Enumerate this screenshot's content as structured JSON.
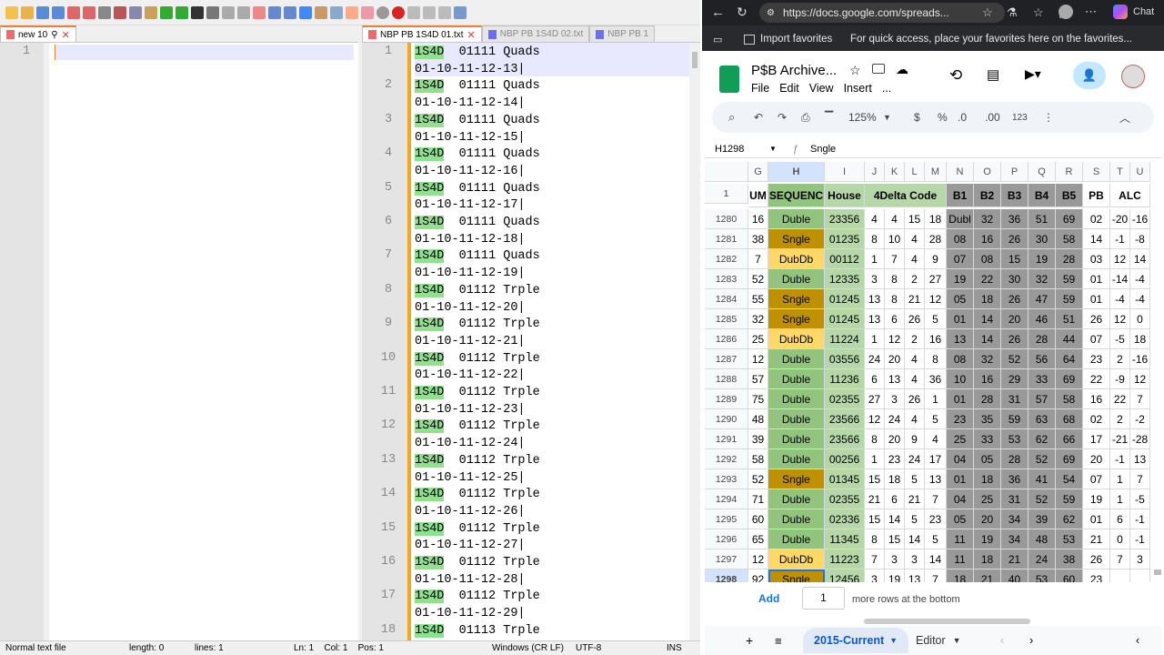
{
  "npp": {
    "tabs": [
      {
        "label": "new 10",
        "active": true
      },
      {
        "label": "NBP PB 1S4D 01.txt",
        "active": true
      },
      {
        "label": "NBP PB 1S4D 02.txt",
        "active": false
      },
      {
        "label": "NBP PB 1",
        "active": false
      }
    ],
    "left_line": "1",
    "right_lines": [
      {
        "n": "1",
        "tag": "1S4D",
        "code": "01111",
        "kind": "Quads",
        "seq": "01-10-11-12-13|"
      },
      {
        "n": "2",
        "tag": "1S4D",
        "code": "01111",
        "kind": "Quads",
        "seq": "01-10-11-12-14|"
      },
      {
        "n": "3",
        "tag": "1S4D",
        "code": "01111",
        "kind": "Quads",
        "seq": "01-10-11-12-15|"
      },
      {
        "n": "4",
        "tag": "1S4D",
        "code": "01111",
        "kind": "Quads",
        "seq": "01-10-11-12-16|"
      },
      {
        "n": "5",
        "tag": "1S4D",
        "code": "01111",
        "kind": "Quads",
        "seq": "01-10-11-12-17|"
      },
      {
        "n": "6",
        "tag": "1S4D",
        "code": "01111",
        "kind": "Quads",
        "seq": "01-10-11-12-18|"
      },
      {
        "n": "7",
        "tag": "1S4D",
        "code": "01111",
        "kind": "Quads",
        "seq": "01-10-11-12-19|"
      },
      {
        "n": "8",
        "tag": "1S4D",
        "code": "01112",
        "kind": "Trple",
        "seq": "01-10-11-12-20|"
      },
      {
        "n": "9",
        "tag": "1S4D",
        "code": "01112",
        "kind": "Trple",
        "seq": "01-10-11-12-21|"
      },
      {
        "n": "10",
        "tag": "1S4D",
        "code": "01112",
        "kind": "Trple",
        "seq": "01-10-11-12-22|"
      },
      {
        "n": "11",
        "tag": "1S4D",
        "code": "01112",
        "kind": "Trple",
        "seq": "01-10-11-12-23|"
      },
      {
        "n": "12",
        "tag": "1S4D",
        "code": "01112",
        "kind": "Trple",
        "seq": "01-10-11-12-24|"
      },
      {
        "n": "13",
        "tag": "1S4D",
        "code": "01112",
        "kind": "Trple",
        "seq": "01-10-11-12-25|"
      },
      {
        "n": "14",
        "tag": "1S4D",
        "code": "01112",
        "kind": "Trple",
        "seq": "01-10-11-12-26|"
      },
      {
        "n": "15",
        "tag": "1S4D",
        "code": "01112",
        "kind": "Trple",
        "seq": "01-10-11-12-27|"
      },
      {
        "n": "16",
        "tag": "1S4D",
        "code": "01112",
        "kind": "Trple",
        "seq": "01-10-11-12-28|"
      },
      {
        "n": "17",
        "tag": "1S4D",
        "code": "01112",
        "kind": "Trple",
        "seq": "01-10-11-12-29|"
      },
      {
        "n": "18",
        "tag": "1S4D",
        "code": "01113",
        "kind": "Trple",
        "seq": ""
      }
    ],
    "status": {
      "type": "Normal text file",
      "length": "length: 0",
      "lines": "lines: 1",
      "pos": "Ln: 1    Col: 1    Pos: 1",
      "eol": "Windows (CR LF)",
      "enc": "UTF-8",
      "mode": "INS"
    }
  },
  "chrome": {
    "url": "https://docs.google.com/spreads...",
    "chat": "Chat",
    "fav_import": "Import favorites",
    "fav_hint": "For quick access, place your favorites here on the favorites...",
    "doc_title": "P$B Archive...",
    "menu": [
      "File",
      "Edit",
      "View",
      "Insert",
      "..."
    ],
    "zoom": "125%",
    "fmt_currency": "$",
    "fmt_percent": "%",
    "fmt_dec_dec": ".0",
    "fmt_dec_inc": ".00",
    "fmt_123": "123",
    "cell_ref": "H1298",
    "formula": "Sngle",
    "col_letters": [
      "G",
      "H",
      "I",
      "J",
      "K",
      "L",
      "M",
      "N",
      "O",
      "P",
      "Q",
      "R",
      "S",
      "T",
      "U"
    ],
    "header_row": {
      "n": "1",
      "cells": [
        "UM",
        "SEQUENC",
        "House",
        "4Delta Code",
        "B1",
        "B2",
        "B3",
        "B4",
        "B5",
        "PB",
        "ALC"
      ]
    },
    "rows": [
      {
        "n": "1280",
        "g": "16",
        "h": "Duble",
        "i": "23356",
        "d": [
          "4",
          "4",
          "15",
          "18"
        ],
        "b": [
          "Dubl",
          "32",
          "36",
          "51",
          "69"
        ],
        "pb": "02",
        "t": "-20",
        "u": "-16",
        "t_class": "green"
      },
      {
        "n": "1281",
        "g": "38",
        "h": "Sngle",
        "i": "01235",
        "d": [
          "8",
          "10",
          "4",
          "28"
        ],
        "b": [
          "08",
          "16",
          "26",
          "30",
          "58"
        ],
        "pb": "14",
        "t": "-1",
        "u": "-8",
        "t_class": "gold"
      },
      {
        "n": "1282",
        "g": "7",
        "h": "DubDb",
        "i": "00112",
        "d": [
          "1",
          "7",
          "4",
          "9"
        ],
        "b": [
          "07",
          "08",
          "15",
          "19",
          "28"
        ],
        "pb": "03",
        "t": "12",
        "u": "14",
        "t_class": "yellow"
      },
      {
        "n": "1283",
        "g": "52",
        "h": "Duble",
        "i": "12335",
        "d": [
          "3",
          "8",
          "2",
          "27"
        ],
        "b": [
          "19",
          "22",
          "30",
          "32",
          "59"
        ],
        "pb": "01",
        "t": "-14",
        "u": "-4",
        "t_class": "green"
      },
      {
        "n": "1284",
        "g": "55",
        "h": "Sngle",
        "i": "01245",
        "d": [
          "13",
          "8",
          "21",
          "12"
        ],
        "b": [
          "05",
          "18",
          "26",
          "47",
          "59"
        ],
        "pb": "01",
        "t": "-4",
        "u": "-4",
        "t_class": "gold"
      },
      {
        "n": "1285",
        "g": "32",
        "h": "Sngle",
        "i": "01245",
        "d": [
          "13",
          "6",
          "26",
          "5"
        ],
        "b": [
          "01",
          "14",
          "20",
          "46",
          "51"
        ],
        "pb": "26",
        "t": "12",
        "u": "0",
        "t_class": "gold"
      },
      {
        "n": "1286",
        "g": "25",
        "h": "DubDb",
        "i": "11224",
        "d": [
          "1",
          "12",
          "2",
          "16"
        ],
        "b": [
          "13",
          "14",
          "26",
          "28",
          "44"
        ],
        "pb": "07",
        "t": "-5",
        "u": "18",
        "t_class": "yellow"
      },
      {
        "n": "1287",
        "g": "12",
        "h": "Duble",
        "i": "03556",
        "d": [
          "24",
          "20",
          "4",
          "8"
        ],
        "b": [
          "08",
          "32",
          "52",
          "56",
          "64"
        ],
        "pb": "23",
        "t": "2",
        "u": "-16",
        "t_class": "green"
      },
      {
        "n": "1288",
        "g": "57",
        "h": "Duble",
        "i": "11236",
        "d": [
          "6",
          "13",
          "4",
          "36"
        ],
        "b": [
          "10",
          "16",
          "29",
          "33",
          "69"
        ],
        "pb": "22",
        "t": "-9",
        "u": "12",
        "t_class": "green"
      },
      {
        "n": "1289",
        "g": "75",
        "h": "Duble",
        "i": "02355",
        "d": [
          "27",
          "3",
          "26",
          "1"
        ],
        "b": [
          "01",
          "28",
          "31",
          "57",
          "58"
        ],
        "pb": "16",
        "t": "22",
        "u": "7",
        "t_class": "green"
      },
      {
        "n": "1290",
        "g": "48",
        "h": "Duble",
        "i": "23566",
        "d": [
          "12",
          "24",
          "4",
          "5"
        ],
        "b": [
          "23",
          "35",
          "59",
          "63",
          "68"
        ],
        "pb": "02",
        "t": "2",
        "u": "-2",
        "t_class": "green"
      },
      {
        "n": "1291",
        "g": "39",
        "h": "Duble",
        "i": "23566",
        "d": [
          "8",
          "20",
          "9",
          "4"
        ],
        "b": [
          "25",
          "33",
          "53",
          "62",
          "66"
        ],
        "pb": "17",
        "t": "-21",
        "u": "-28",
        "t_class": "green"
      },
      {
        "n": "1292",
        "g": "58",
        "h": "Duble",
        "i": "00256",
        "d": [
          "1",
          "23",
          "24",
          "17"
        ],
        "b": [
          "04",
          "05",
          "28",
          "52",
          "69"
        ],
        "pb": "20",
        "t": "-1",
        "u": "13",
        "t_class": "green"
      },
      {
        "n": "1293",
        "g": "52",
        "h": "Sngle",
        "i": "01345",
        "d": [
          "15",
          "18",
          "5",
          "13"
        ],
        "b": [
          "01",
          "18",
          "36",
          "41",
          "54"
        ],
        "pb": "07",
        "t": "1",
        "u": "7",
        "t_class": "gold"
      },
      {
        "n": "1294",
        "g": "71",
        "h": "Duble",
        "i": "02355",
        "d": [
          "21",
          "6",
          "21",
          "7"
        ],
        "b": [
          "04",
          "25",
          "31",
          "52",
          "59"
        ],
        "pb": "19",
        "t": "1",
        "u": "-5",
        "t_class": "green"
      },
      {
        "n": "1295",
        "g": "60",
        "h": "Duble",
        "i": "02336",
        "d": [
          "15",
          "14",
          "5",
          "23"
        ],
        "b": [
          "05",
          "20",
          "34",
          "39",
          "62"
        ],
        "pb": "01",
        "t": "6",
        "u": "-1",
        "t_class": "green"
      },
      {
        "n": "1296",
        "g": "65",
        "h": "Duble",
        "i": "11345",
        "d": [
          "8",
          "15",
          "14",
          "5"
        ],
        "b": [
          "11",
          "19",
          "34",
          "48",
          "53"
        ],
        "pb": "21",
        "t": "0",
        "u": "-1",
        "t_class": "green"
      },
      {
        "n": "1297",
        "g": "12",
        "h": "DubDb",
        "i": "11223",
        "d": [
          "7",
          "3",
          "3",
          "14"
        ],
        "b": [
          "11",
          "18",
          "21",
          "24",
          "38"
        ],
        "pb": "26",
        "t": "7",
        "u": "3",
        "t_class": "yellow"
      },
      {
        "n": "1298",
        "g": "92",
        "h": "Sngle",
        "i": "12456",
        "d": [
          "3",
          "19",
          "13",
          "7"
        ],
        "b": [
          "18",
          "21",
          "40",
          "53",
          "60"
        ],
        "pb": "23",
        "t": "",
        "u": "",
        "t_class": "gold"
      }
    ],
    "add_button": "Add",
    "add_count": "1",
    "add_suffix": "more rows at the bottom",
    "sheet_tabs": [
      "2015-Current",
      "Editor"
    ],
    "colors": {
      "green": "#93c47d",
      "gold": "#bf9000",
      "yellow": "#ffd966",
      "house": "#b6d7a8",
      "gray": "#999999",
      "accent": "#1a73e8"
    }
  }
}
